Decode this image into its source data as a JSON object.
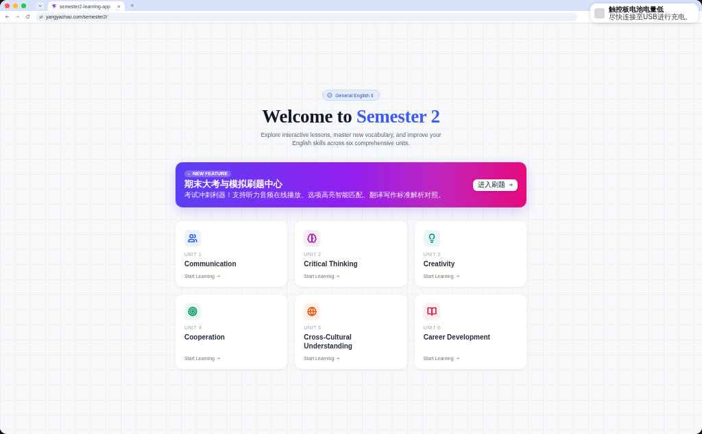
{
  "browser": {
    "tab": {
      "title": "semester2-learning-app"
    },
    "address": "yangyachao.com/semester2/"
  },
  "notification": {
    "title": "触控板电池电量低",
    "body": "尽快连接至USB进行充电。"
  },
  "hero": {
    "badge": "General English II",
    "title": "Welcome to",
    "title_highlight": "Semester 2",
    "subtitle": "Explore interactive lessons, master new vocabulary, and improve your English skills across six comprehensive units."
  },
  "banner": {
    "badge": "NEW FEATURE",
    "title": "期末大考与模拟刷题中心",
    "description": "考试冲刺利器！支持听力音频在线播放、选项高亮智能匹配、翻译写作标准解析对照。",
    "button": "进入刷题"
  },
  "units": [
    {
      "kind": "people",
      "color": "#2563eb",
      "label": "UNIT 1",
      "title": "Communication",
      "link": "Start Learning"
    },
    {
      "kind": "brain",
      "color": "#a21caf",
      "label": "UNIT 2",
      "title": "Critical Thinking",
      "link": "Start Learning"
    },
    {
      "kind": "bulb",
      "color": "#0d9488",
      "label": "UNIT 3",
      "title": "Creativity",
      "link": "Start Learning"
    },
    {
      "kind": "target",
      "color": "#059669",
      "label": "UNIT 4",
      "title": "Cooperation",
      "link": "Start Learning"
    },
    {
      "kind": "globe",
      "color": "#ea580c",
      "label": "UNIT 5",
      "title": "Cross-Cultural Understanding",
      "link": "Start Learning"
    },
    {
      "kind": "book",
      "color": "#e11d48",
      "label": "UNIT 6",
      "title": "Career Development",
      "link": "Start Learning"
    }
  ]
}
